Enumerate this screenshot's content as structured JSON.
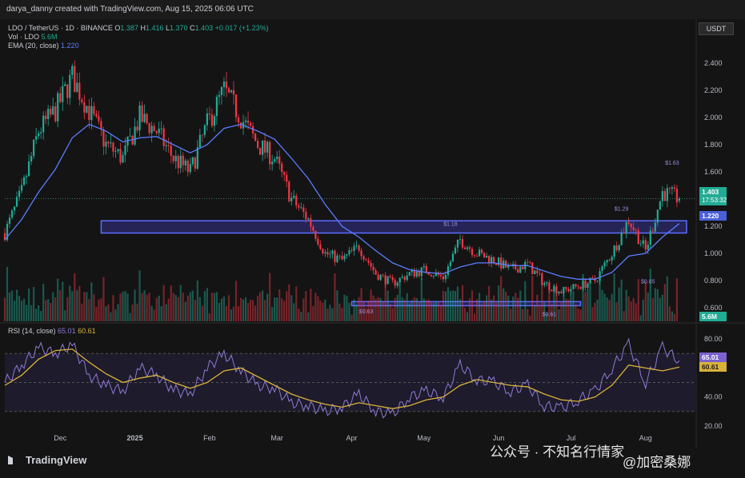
{
  "header": {
    "credit": "darya_danny created with TradingView.com, Aug 15, 2025 06:06 UTC"
  },
  "legend": {
    "symbol": "LDO / TetherUS · 1D · BINANCE",
    "o_label": "O",
    "o": "1.387",
    "h_label": "H",
    "h": "1.416",
    "l_label": "L",
    "l": "1.370",
    "c_label": "C",
    "c": "1.403",
    "change": "+0.017 (+1.23%)",
    "vol_label": "Vol · LDO",
    "vol": "5.6M",
    "ema_label": "EMA (20, close)",
    "ema": "1.220",
    "rsi_label": "RSI (14, close)",
    "rsi": "65.01",
    "rsi_ma": "60.61"
  },
  "currency_button": "USDT",
  "price_badges": {
    "last": "1.403",
    "countdown": "17:53:32",
    "ema": "1.220",
    "volume": "5.6M",
    "rsi": "65.01",
    "rsi_ma": "60.61"
  },
  "annotations": [
    "$1.63",
    "$1.29",
    "$1.18",
    "$0.85",
    "$0.63",
    "$0.61"
  ],
  "footer": {
    "brand": "TradingView",
    "watermark_1": "公众号 · 不知名行情家",
    "watermark_2": "@加密桑娜"
  },
  "colors": {
    "background": "#141414",
    "up": "#22ab94",
    "down": "#f23645",
    "ema": "#5b7cff",
    "rsi": "#8f7ad6",
    "rsi_ma": "#d9b23a",
    "zone": "#2c2a6e"
  },
  "chart_data": [
    {
      "type": "candlestick",
      "title": "LDO / TetherUS · 1D · BINANCE",
      "ylim": [
        0.5,
        2.5
      ],
      "y_ticks": [
        "2.400",
        "2.200",
        "2.000",
        "1.800",
        "1.600",
        "1.400",
        "1.200",
        "1.000",
        "0.800",
        "0.600"
      ],
      "x_ticks": [
        "Dec",
        "2025",
        "Feb",
        "Mar",
        "Apr",
        "May",
        "Jun",
        "Jul",
        "Aug"
      ],
      "dates": [
        "2024-11-08",
        "2024-11-15",
        "2024-11-22",
        "2024-11-29",
        "2024-12-06",
        "2024-12-13",
        "2024-12-20",
        "2024-12-27",
        "2025-01-03",
        "2025-01-10",
        "2025-01-17",
        "2025-01-24",
        "2025-01-31",
        "2025-02-07",
        "2025-02-14",
        "2025-02-21",
        "2025-02-28",
        "2025-03-07",
        "2025-03-14",
        "2025-03-21",
        "2025-03-28",
        "2025-04-04",
        "2025-04-11",
        "2025-04-18",
        "2025-04-25",
        "2025-05-02",
        "2025-05-09",
        "2025-05-16",
        "2025-05-23",
        "2025-05-30",
        "2025-06-06",
        "2025-06-13",
        "2025-06-20",
        "2025-06-27",
        "2025-07-04",
        "2025-07-11",
        "2025-07-18",
        "2025-07-25",
        "2025-08-01",
        "2025-08-08",
        "2025-08-15"
      ],
      "close": [
        1.15,
        1.45,
        1.9,
        2.05,
        2.3,
        2.05,
        1.8,
        1.7,
        2.0,
        1.9,
        1.7,
        1.6,
        1.95,
        2.2,
        2.0,
        1.8,
        1.7,
        1.4,
        1.25,
        1.0,
        0.95,
        1.05,
        0.85,
        0.78,
        0.85,
        0.88,
        0.82,
        1.1,
        1.0,
        0.95,
        0.88,
        0.92,
        0.78,
        0.72,
        0.76,
        0.8,
        1.0,
        1.25,
        1.02,
        1.45,
        1.403
      ],
      "ema": [
        1.1,
        1.25,
        1.45,
        1.62,
        1.85,
        1.95,
        1.9,
        1.82,
        1.85,
        1.86,
        1.8,
        1.74,
        1.8,
        1.92,
        1.95,
        1.9,
        1.84,
        1.7,
        1.55,
        1.36,
        1.2,
        1.12,
        1.02,
        0.93,
        0.88,
        0.86,
        0.85,
        0.9,
        0.93,
        0.93,
        0.91,
        0.91,
        0.87,
        0.83,
        0.81,
        0.81,
        0.86,
        0.98,
        1.0,
        1.12,
        1.22
      ],
      "annotations": [
        {
          "label": "$1.63",
          "date": "2025-08-12",
          "value": 1.63
        },
        {
          "label": "$1.29",
          "date": "2025-07-22",
          "value": 1.29
        },
        {
          "label": "$1.18",
          "date": "2025-05-12",
          "value": 1.18
        },
        {
          "label": "$0.85",
          "date": "2025-08-02",
          "value": 0.85
        },
        {
          "label": "$0.63",
          "date": "2025-04-07",
          "value": 0.63
        },
        {
          "label": "$0.61",
          "date": "2025-06-22",
          "value": 0.61
        }
      ],
      "zones": [
        {
          "from": "2024-12-18",
          "to": "2025-08-18",
          "low": 1.15,
          "high": 1.24
        },
        {
          "from": "2025-04-01",
          "to": "2025-07-05",
          "low": 0.615,
          "high": 0.645
        }
      ]
    },
    {
      "type": "line",
      "title": "RSI (14, close)",
      "ylim": [
        15,
        85
      ],
      "y_ticks": [
        "80.00",
        "60.00",
        "40.00",
        "20.00"
      ],
      "levels": [
        70,
        50,
        30
      ],
      "series": [
        {
          "name": "RSI",
          "values": [
            50,
            62,
            74,
            70,
            76,
            55,
            48,
            44,
            60,
            55,
            45,
            42,
            60,
            70,
            58,
            48,
            46,
            36,
            34,
            30,
            33,
            42,
            30,
            28,
            40,
            44,
            40,
            62,
            52,
            50,
            44,
            48,
            34,
            32,
            38,
            44,
            60,
            76,
            50,
            74,
            65.01
          ]
        },
        {
          "name": "RSI MA",
          "values": [
            48,
            55,
            66,
            72,
            73,
            64,
            56,
            50,
            53,
            55,
            50,
            46,
            50,
            58,
            60,
            54,
            48,
            42,
            38,
            35,
            33,
            36,
            34,
            32,
            34,
            38,
            40,
            48,
            52,
            50,
            48,
            47,
            42,
            38,
            37,
            40,
            48,
            62,
            60,
            58,
            60.61
          ]
        }
      ]
    }
  ]
}
